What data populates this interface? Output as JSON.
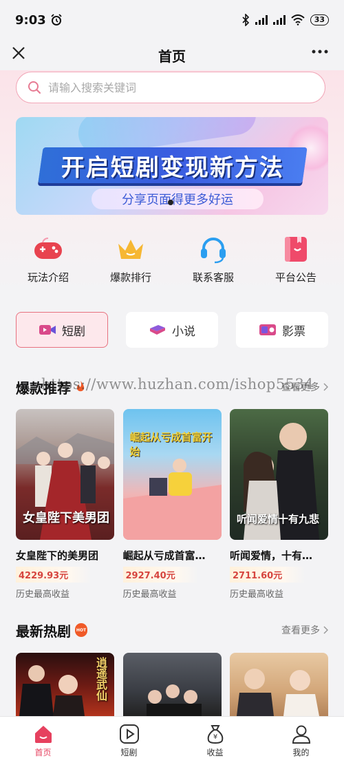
{
  "status_bar": {
    "time": "9:03",
    "battery": "33"
  },
  "header": {
    "title": "首页"
  },
  "search": {
    "placeholder": "请输入搜索关键词"
  },
  "banner": {
    "title": "开启短剧变现新方法",
    "subtitle": "分享页面得更多好运"
  },
  "quick_actions": [
    {
      "label": "玩法介绍",
      "icon": "gamepad-icon",
      "color": "#e8434f"
    },
    {
      "label": "爆款排行",
      "icon": "crown-icon",
      "color": "#f6a623"
    },
    {
      "label": "联系客服",
      "icon": "headset-icon",
      "color": "#2b9ef0"
    },
    {
      "label": "平台公告",
      "icon": "notice-book-icon",
      "color": "#ef4a6a"
    }
  ],
  "tabs": [
    {
      "label": "短剧",
      "icon": "video-icon",
      "active": true
    },
    {
      "label": "小说",
      "icon": "book-icon",
      "active": false
    },
    {
      "label": "影票",
      "icon": "film-ticket-icon",
      "active": false
    }
  ],
  "hot_section": {
    "title": "爆款推荐",
    "more": "查看更多",
    "watermark": "https://www.huzhan.com/ishop5534",
    "items": [
      {
        "name": "女皇陛下的美男团",
        "amount": "4229.93元",
        "note": "历史最高收益",
        "poster_text": "女皇陛下美男团"
      },
      {
        "name": "崛起从亏成首富…",
        "amount": "2927.40元",
        "note": "历史最高收益",
        "poster_text": "崛起从亏成首富开始"
      },
      {
        "name": "听闻爱情，十有…",
        "amount": "2711.60元",
        "note": "历史最高收益",
        "poster_text": "听闻爱情十有九悲"
      }
    ]
  },
  "new_section": {
    "title": "最新热剧",
    "badge": "HOT",
    "more": "查看更多",
    "items": [
      {
        "poster_text": "逍遥武仙"
      },
      {
        "poster_text": ""
      },
      {
        "poster_text": ""
      }
    ]
  },
  "bottom_nav": [
    {
      "label": "首页",
      "icon": "home-icon",
      "active": true
    },
    {
      "label": "短剧",
      "icon": "play-icon",
      "active": false
    },
    {
      "label": "收益",
      "icon": "money-bag-icon",
      "active": false
    },
    {
      "label": "我的",
      "icon": "user-icon",
      "active": false
    }
  ],
  "colors": {
    "accent": "#e6415f",
    "amount": "#d6453f"
  }
}
